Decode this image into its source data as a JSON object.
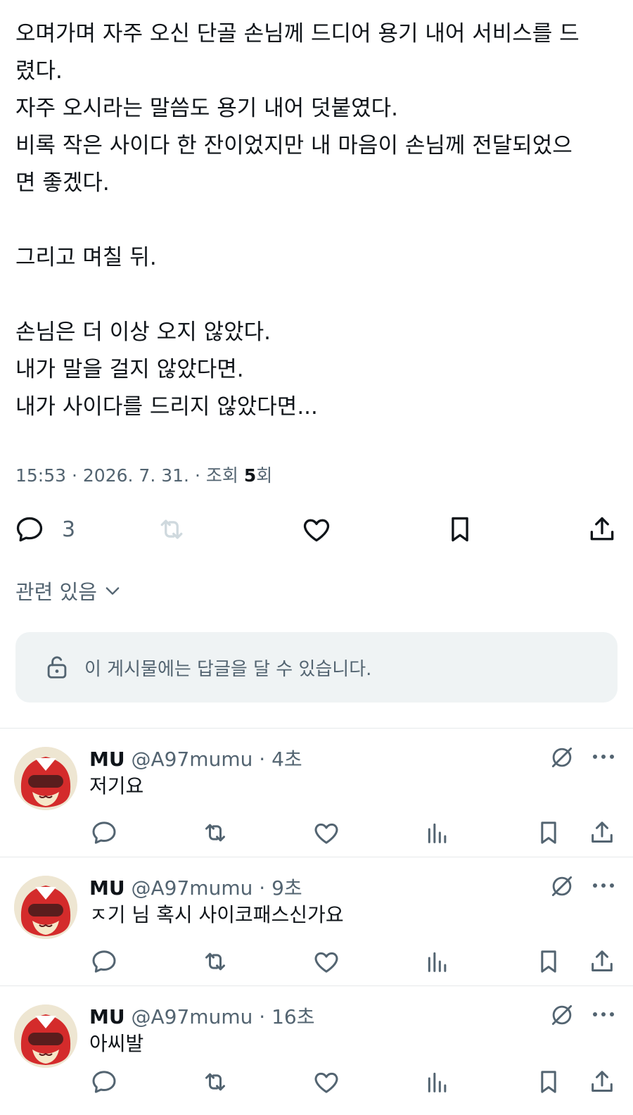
{
  "post": {
    "lines": [
      "오며가며 자주 오신 단골 손님께 드디어 용기 내어 서비스를 드",
      "렸다.",
      "자주 오시라는 말씀도 용기 내어 덧붙였다.",
      "비록 작은 사이다 한 잔이었지만 내 마음이 손님께 전달되었으",
      "면 좋겠다.",
      "",
      "그리고 며칠 뒤.",
      "",
      "손님은 더 이상 오지 않았다.",
      "내가 말을 걸지 않았다면.",
      "내가 사이다를 드리지 않았다면..."
    ],
    "meta": {
      "time": "15:53",
      "date": "2026. 7. 31.",
      "views_label": "조회",
      "views_count": "5",
      "views_suffix": "회"
    },
    "actions": {
      "reply_count": "3"
    },
    "related_label": "관련 있음",
    "reply_restriction": "이 게시물에는 답글을 달 수 있습니다."
  },
  "replies": [
    {
      "name": "MU",
      "handle": "@A97mumu",
      "time": "4초",
      "text": "저기요"
    },
    {
      "name": "MU",
      "handle": "@A97mumu",
      "time": "9초",
      "text": "ㅈ기 님 혹시 사이코패스신가요"
    },
    {
      "name": "MU",
      "handle": "@A97mumu",
      "time": "16초",
      "text": "아씨발"
    }
  ],
  "colors": {
    "text_primary": "#0f1419",
    "text_secondary": "#536471",
    "disabled_icon": "#cfd9de",
    "reply_box_bg": "#eff3f4",
    "avatar_red": "#d42b2b"
  },
  "icons": {
    "reply": "speech-bubble-icon",
    "repost": "repost-icon",
    "like": "heart-icon",
    "bookmark": "bookmark-icon",
    "share": "share-icon",
    "views": "bar-chart-icon",
    "grok": "grok-icon",
    "more": "more-dots-icon",
    "lock": "unlock-icon",
    "chevron": "chevron-down-icon"
  }
}
